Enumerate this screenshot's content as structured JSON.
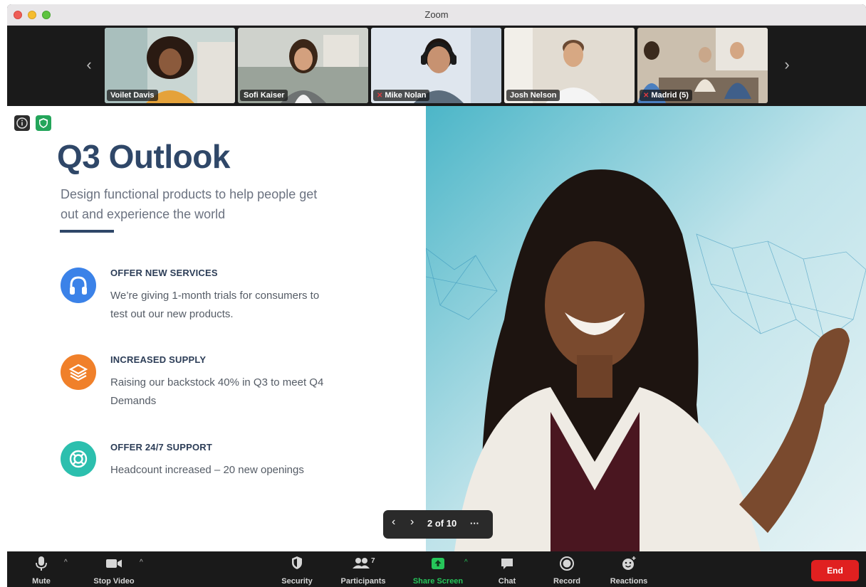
{
  "window": {
    "title": "Zoom"
  },
  "gallery": {
    "participants": [
      {
        "name": "Voilet Davis",
        "muted": false
      },
      {
        "name": "Sofi Kaiser",
        "muted": false
      },
      {
        "name": "Mike Nolan",
        "muted": true
      },
      {
        "name": "Josh Nelson",
        "muted": false
      },
      {
        "name": "Madrid (5)",
        "muted": true
      }
    ]
  },
  "slide": {
    "title": "Q3 Outlook",
    "subtitle": "Design functional products to help people get out and experience the world",
    "features": [
      {
        "icon": "headphones-icon",
        "heading": "OFFER NEW SERVICES",
        "body": "We’re giving 1-month trials for consumers to test out our new products.",
        "color": "#3b82e8"
      },
      {
        "icon": "layers-icon",
        "heading": "INCREASED SUPPLY",
        "body": "Raising our backstock 40% in Q3 to meet Q4 Demands",
        "color": "#f0802a"
      },
      {
        "icon": "lifebuoy-icon",
        "heading": "OFFER 24/7 SUPPORT",
        "body": "Headcount increased – 20 new openings",
        "color": "#2cbfae"
      }
    ]
  },
  "slide_nav": {
    "page": "2 of 10",
    "more": "···"
  },
  "toolbar": {
    "mute": "Mute",
    "stop_video": "Stop Video",
    "security": "Security",
    "participants": "Participants",
    "participant_count": "7",
    "share_screen": "Share Screen",
    "chat": "Chat",
    "record": "Record",
    "reactions": "Reactions",
    "end": "End"
  },
  "colors": {
    "share_green": "#26c65a",
    "end_red": "#e02020",
    "title_navy": "#2f4768"
  }
}
